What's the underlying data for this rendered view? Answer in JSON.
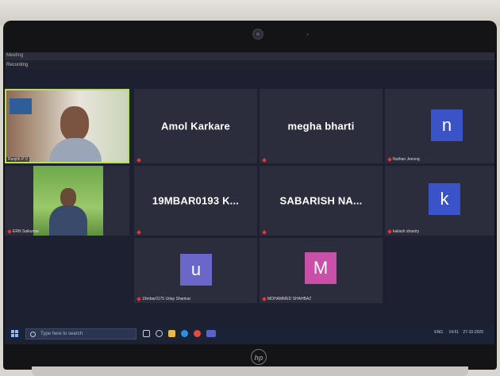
{
  "window": {
    "title": "Meeting",
    "recording_label": "Recording"
  },
  "tiles": [
    {
      "id": "ranjith",
      "label": "Ranjith P V",
      "type": "video"
    },
    {
      "id": "amol",
      "display": "Amol Karkare",
      "type": "name"
    },
    {
      "id": "megha",
      "display": "megha bharti",
      "type": "name"
    },
    {
      "id": "nuthan",
      "label": "Nuthan Jeevraj",
      "type": "avatar",
      "initial": "n",
      "color": "#3a53c9"
    },
    {
      "id": "erin",
      "label": "ERN Saikumar",
      "type": "video"
    },
    {
      "id": "mbar",
      "display": "19MBAR0193  K...",
      "type": "name"
    },
    {
      "id": "sabarish",
      "display": "SABARISH  NA...",
      "type": "name"
    },
    {
      "id": "kailash",
      "label": "kailash shastry",
      "type": "avatar",
      "initial": "k",
      "color": "#3a53c9"
    },
    {
      "id": "u",
      "label": "19mbar0175 Uday Shankar",
      "type": "avatar",
      "initial": "u",
      "color": "#6a67c8"
    },
    {
      "id": "m",
      "label": "MOHAMMED SHAHBAZ",
      "type": "avatar",
      "initial": "M",
      "color": "#c94fa8"
    }
  ],
  "taskbar": {
    "search_placeholder": "Type here to search",
    "tray_lang": "ENG",
    "tray_time": "14:51",
    "tray_date": "27-10-2020"
  },
  "brand": {
    "logo": "hp"
  }
}
